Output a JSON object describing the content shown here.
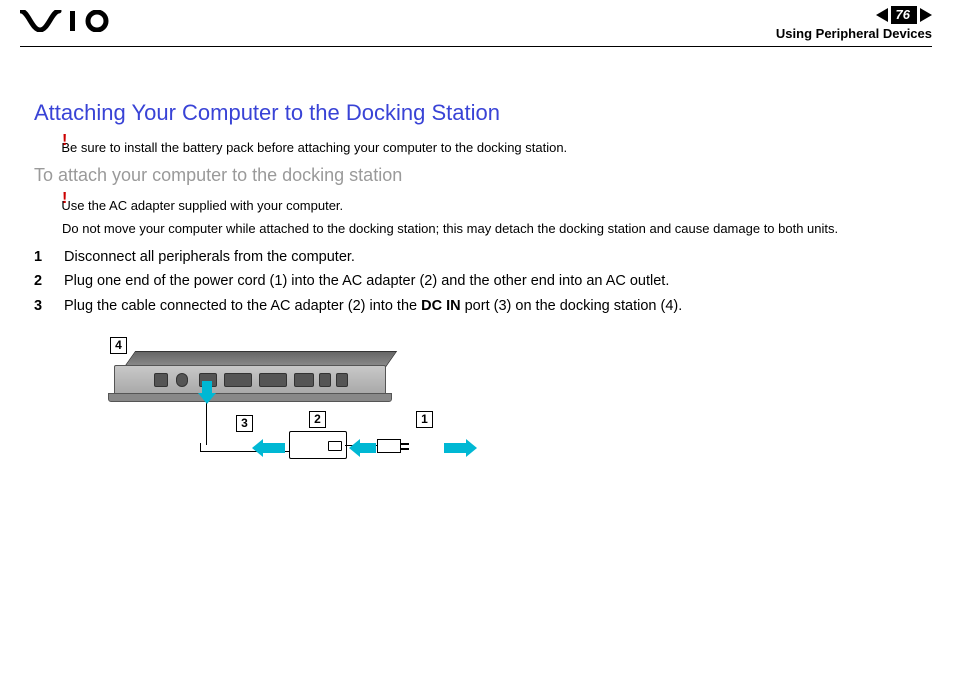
{
  "header": {
    "page_number": "76",
    "section": "Using Peripheral Devices"
  },
  "title": "Attaching Your Computer to the Docking Station",
  "warnings": {
    "w1": "Be sure to install the battery pack before attaching your computer to the docking station."
  },
  "subtitle": "To attach your computer to the docking station",
  "warnings2": {
    "w2": "Use the AC adapter supplied with your computer.",
    "w3": "Do not move your computer while attached to the docking station; this may detach the docking station and cause damage to both units."
  },
  "steps": [
    {
      "num": "1",
      "text": "Disconnect all peripherals from the computer."
    },
    {
      "num": "2",
      "text": "Plug one end of the power cord (1) into the AC adapter (2) and the other end into an AC outlet."
    },
    {
      "num": "3",
      "text_before": "Plug the cable connected to the AC adapter (2) into the ",
      "bold": "DC IN",
      "text_after": " port (3) on the docking station (4)."
    }
  ],
  "diagram": {
    "callout_1": "1",
    "callout_2": "2",
    "callout_3": "3",
    "callout_4": "4"
  }
}
